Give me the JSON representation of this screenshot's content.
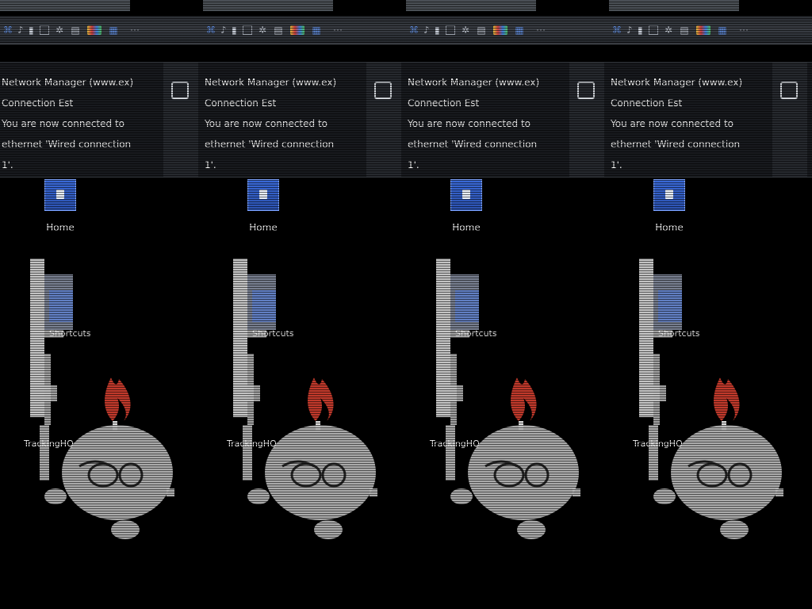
{
  "tiles": [
    {
      "title_bar": "",
      "notification": {
        "title": "Network Manager (www.ex)",
        "subtitle": "Connection Est",
        "line1": "You are now connected to",
        "line2": "ethernet 'Wired connection",
        "line3": "1'."
      },
      "desktop_icon_label": "Home",
      "mascot_label_a": "Shortcuts",
      "mascot_label_b": "TrackingHQ"
    },
    {
      "title_bar": "",
      "notification": {
        "title": "Network Manager (www.ex)",
        "subtitle": "Connection Est",
        "line1": "You are now connected to",
        "line2": "ethernet 'Wired connection",
        "line3": "1'."
      },
      "desktop_icon_label": "Home",
      "mascot_label_a": "Shortcuts",
      "mascot_label_b": "TrackingHQ"
    },
    {
      "title_bar": "",
      "notification": {
        "title": "Network Manager (www.ex)",
        "subtitle": "Connection Est",
        "line1": "You are now connected to",
        "line2": "ethernet 'Wired connection",
        "line3": "1'."
      },
      "desktop_icon_label": "Home",
      "mascot_label_a": "Shortcuts",
      "mascot_label_b": "TrackingHQ"
    },
    {
      "title_bar": "",
      "notification": {
        "title": "Network Manager (www.ex)",
        "subtitle": "Connection Est",
        "line1": "You are now connected to",
        "line2": "ethernet 'Wired connection",
        "line3": "1'."
      },
      "desktop_icon_label": "Home",
      "mascot_label_a": "Shortcuts",
      "mascot_label_b": "TrackingHQ"
    }
  ],
  "panel_icons": [
    {
      "name": "network-icon",
      "glyph": "⌘",
      "style": "blue w10"
    },
    {
      "name": "volume-icon",
      "glyph": "♪",
      "style": "w6"
    },
    {
      "name": "battery-icon",
      "glyph": "▮",
      "style": "w6"
    },
    {
      "name": "window-icon",
      "glyph": "",
      "style": "box w10"
    },
    {
      "name": "settings-icon",
      "glyph": "✲",
      "style": "w10"
    },
    {
      "name": "folder-icon",
      "glyph": "▤",
      "style": "w14"
    },
    {
      "name": "apps-icon",
      "glyph": "",
      "style": "multi w18"
    },
    {
      "name": "browser-icon",
      "glyph": "▦",
      "style": "blue w14"
    },
    {
      "name": "more-icon",
      "glyph": "⋯",
      "style": "w24"
    }
  ],
  "colors": {
    "background": "#000000",
    "panel": "#2b2e33",
    "notification": "#181a1e",
    "accent_blue": "#3a6ad8",
    "flame": "#c0392b"
  }
}
